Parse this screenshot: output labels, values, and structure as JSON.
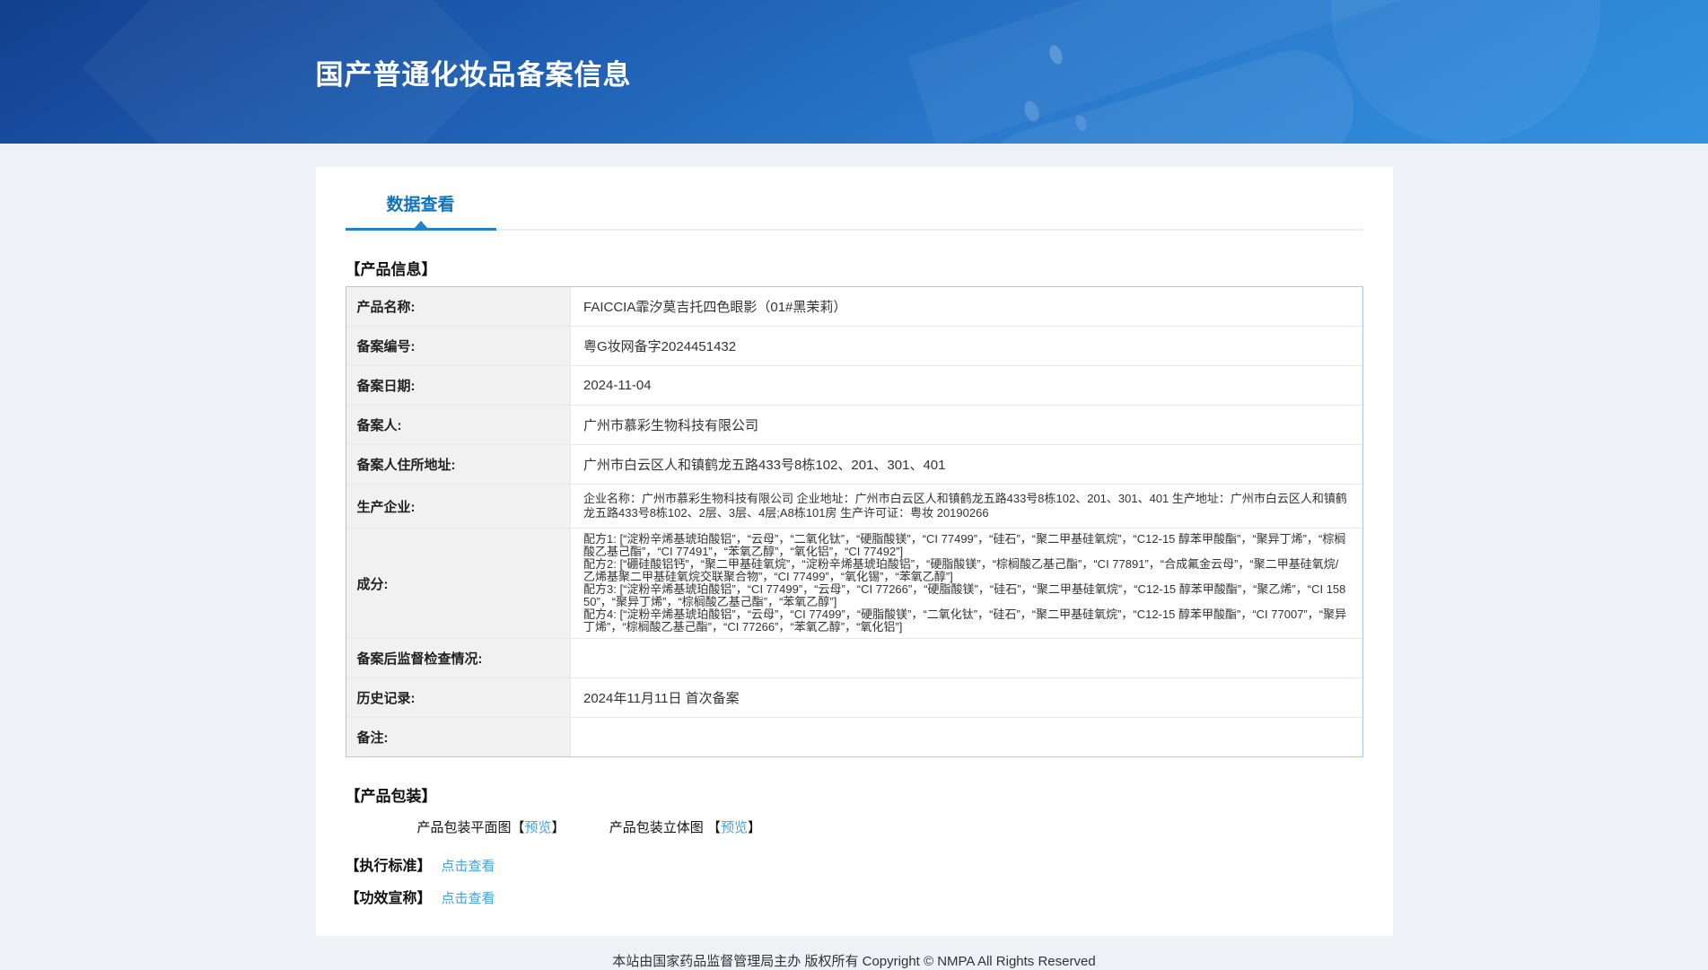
{
  "header": {
    "title": "国产普通化妆品备案信息"
  },
  "tabs": {
    "data_view": "数据查看"
  },
  "sections": {
    "product_info_label": "【产品信息】",
    "product_package_label": "【产品包装】",
    "exec_standard_label": "【执行标准】",
    "efficacy_claim_label": "【功效宣称】"
  },
  "product_table": {
    "rows": [
      {
        "label": "产品名称:",
        "value": "FAICCIA霏汐莫吉托四色眼影（01#黑茉莉）"
      },
      {
        "label": "备案编号:",
        "value": "粤G妆网备字2024451432"
      },
      {
        "label": "备案日期:",
        "value": "2024-11-04"
      },
      {
        "label": "备案人:",
        "value": "广州市慕彩生物科技有限公司"
      },
      {
        "label": "备案人住所地址:",
        "value": "广州市白云区人和镇鹤龙五路433号8栋102、201、301、401"
      },
      {
        "label": "生产企业:",
        "value": "企业名称：广州市慕彩生物科技有限公司 企业地址：广州市白云区人和镇鹤龙五路433号8栋102、201、301、401 生产地址：广州市白云区人和镇鹤龙五路433号8栋102、2层、3层、4层;A8栋101房 生产许可证：粤妆 20190266"
      },
      {
        "label": "成分:",
        "lines": [
          "配方1: [“淀粉辛烯基琥珀酸铝”，“云母”，“二氧化钛”，“硬脂酸镁”，“CI 77499”，“硅石”，“聚二甲基硅氧烷”，“C12-15 醇苯甲酸酯”，“聚异丁烯”，“棕榈酸乙基己酯”，“CI 77491”，“苯氧乙醇”，“氧化铝”，“CI 77492”]",
          "配方2: [“硼硅酸铝钙”，“聚二甲基硅氧烷”，“淀粉辛烯基琥珀酸铝”，“硬脂酸镁”，“棕榈酸乙基己酯”，“CI 77891”，“合成氟金云母”，“聚二甲基硅氧烷/乙烯基聚二甲基硅氧烷交联聚合物”，“CI 77499”，“氧化锡”，“苯氧乙醇”]",
          "配方3: [“淀粉辛烯基琥珀酸铝”，“CI 77499”，“云母”，“CI 77266”，“硬脂酸镁”，“硅石”，“聚二甲基硅氧烷”，“C12-15 醇苯甲酸酯”，“聚乙烯”，“CI 15850”，“聚异丁烯”，“棕榈酸乙基己酯”，“苯氧乙醇”]",
          "配方4: [“淀粉辛烯基琥珀酸铝”，“云母”，“CI 77499”，“硬脂酸镁”，“二氧化钛”，“硅石”，“聚二甲基硅氧烷”，“C12-15 醇苯甲酸酯”，“CI 77007”，“聚异丁烯”，“棕榈酸乙基己酯”，“CI 77266”，“苯氧乙醇”，“氧化铝”]"
        ]
      },
      {
        "label": "备案后监督检查情况:",
        "value": ""
      },
      {
        "label": "历史记录:",
        "value": "2024年11月11日 首次备案"
      },
      {
        "label": "备注:",
        "value": ""
      }
    ]
  },
  "packaging": {
    "flat_label": "产品包装平面图",
    "stereo_label": "产品包装立体图",
    "preview_label": "预览",
    "bracket_open": "【",
    "bracket_close": "】"
  },
  "links": {
    "view_label": "点击查看"
  },
  "footer": {
    "copyright": "本站由国家药品监督管理局主办 版权所有 Copyright © NMPA All Rights Reserved"
  },
  "colors": {
    "header_gradient_start": "#123f8f",
    "header_gradient_end": "#3392e0",
    "tab_blue": "#1273bb",
    "tab_underline": "#1e82cb",
    "link_blue": "#4aa0dc",
    "table_outer_border": "#a9cbe8",
    "table_inner_border": "#e8e8e8",
    "label_cell_bg": "#f1f1f1",
    "page_bg": "#eef1f5"
  }
}
